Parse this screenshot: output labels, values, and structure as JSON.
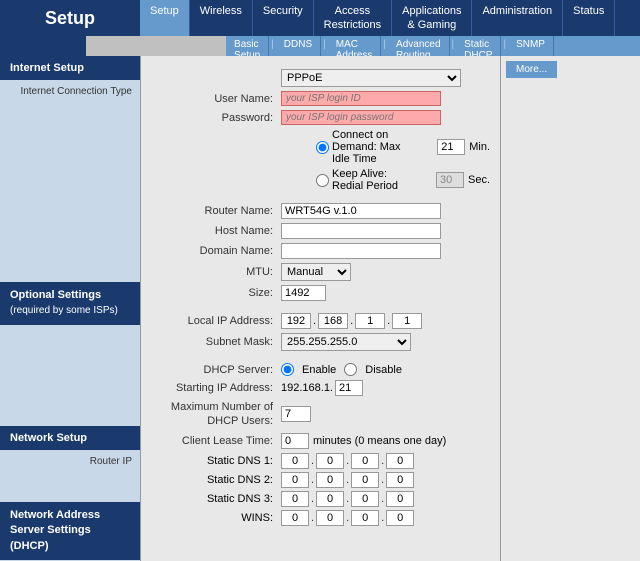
{
  "header": {
    "title": "Setup",
    "tabs": [
      {
        "label": "Setup",
        "active": true
      },
      {
        "label": "Wireless",
        "active": false
      },
      {
        "label": "Security",
        "active": false
      },
      {
        "label": "Access\nRestrictions",
        "active": false
      },
      {
        "label": "Applications\n& Gaming",
        "active": false
      },
      {
        "label": "Administration",
        "active": false
      },
      {
        "label": "Status",
        "active": false
      }
    ],
    "subnav": [
      {
        "label": "Basic Setup"
      },
      {
        "label": "DDNS"
      },
      {
        "label": "MAC Address Clone"
      },
      {
        "label": "Advanced Routing"
      },
      {
        "label": "Static DHCP"
      },
      {
        "label": "SNMP"
      }
    ]
  },
  "more_button": "More...",
  "sidebar": {
    "sections": [
      {
        "title": "Internet Setup",
        "items": [
          "Internet Connection Type"
        ]
      },
      {
        "title": "Optional Settings",
        "subtitle": "(required by some ISPs)",
        "items": []
      },
      {
        "title": "Network Setup",
        "items": [
          "Router IP"
        ]
      },
      {
        "title": "Network Address\nServer Settings (DHCP)",
        "items": []
      }
    ]
  },
  "form": {
    "connection_type": "PPPoE",
    "username_placeholder": "your ISP login ID",
    "password_placeholder": "your ISP login password",
    "connect_on_demand": "Connect on Demand: Max Idle Time",
    "idle_time_value": "21",
    "idle_time_unit": "Min.",
    "keep_alive": "Keep Alive: Redial Period",
    "redial_value": "30",
    "redial_unit": "Sec.",
    "router_name_label": "Router Name:",
    "router_name_value": "WRT54G v.1.0",
    "host_name_label": "Host Name:",
    "host_name_value": "",
    "domain_name_label": "Domain Name:",
    "domain_name_value": "",
    "mtu_label": "MTU:",
    "mtu_value": "Manual",
    "size_label": "Size:",
    "size_value": "1492",
    "local_ip_label": "Local IP Address:",
    "local_ip": [
      "192",
      "168",
      "1",
      "1"
    ],
    "subnet_mask_label": "Subnet Mask:",
    "subnet_mask_value": "255.255.255.0",
    "dhcp_server_label": "DHCP Server:",
    "dhcp_enable": "Enable",
    "dhcp_disable": "Disable",
    "starting_ip_label": "Starting IP Address:",
    "starting_ip_prefix": "192.168.1.",
    "starting_ip_suffix": "21",
    "max_dhcp_label": "Maximum Number of\nDHCP Users:",
    "max_dhcp_value": "7",
    "client_lease_label": "Client Lease Time:",
    "client_lease_value": "0",
    "client_lease_unit": "minutes (0 means one day)",
    "static_dns1_label": "Static DNS 1:",
    "static_dns1": [
      "0",
      "0",
      "0",
      "0"
    ],
    "static_dns2_label": "Static DNS 2:",
    "static_dns2": [
      "0",
      "0",
      "0",
      "0"
    ],
    "static_dns3_label": "Static DNS 3:",
    "static_dns3": [
      "0",
      "0",
      "0",
      "0"
    ],
    "wins_label": "WINS:",
    "wins": [
      "0",
      "0",
      "0",
      "0"
    ]
  }
}
